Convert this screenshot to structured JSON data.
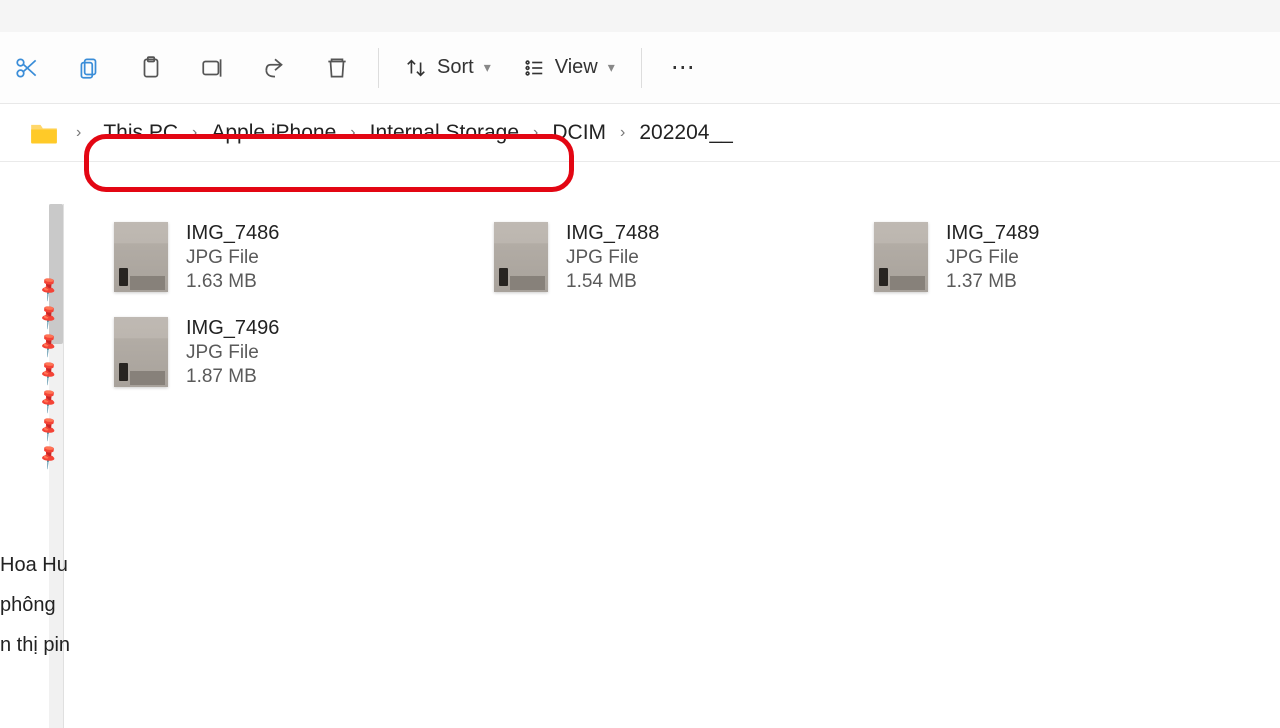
{
  "toolbar": {
    "sort_label": "Sort",
    "view_label": "View"
  },
  "breadcrumb": {
    "items": [
      "This PC",
      "Apple iPhone",
      "Internal Storage",
      "DCIM"
    ],
    "current": "202204__"
  },
  "sidebar": {
    "pinned_count": 7,
    "visible_labels": [
      "Hoa Hu",
      "phông",
      "n thị pin"
    ]
  },
  "files": [
    {
      "name": "IMG_7486",
      "type": "JPG File",
      "size": "1.63 MB"
    },
    {
      "name": "IMG_7488",
      "type": "JPG File",
      "size": "1.54 MB"
    },
    {
      "name": "IMG_7489",
      "type": "JPG File",
      "size": "1.37 MB"
    },
    {
      "name": "IMG_7496",
      "type": "JPG File",
      "size": "1.87 MB"
    }
  ]
}
